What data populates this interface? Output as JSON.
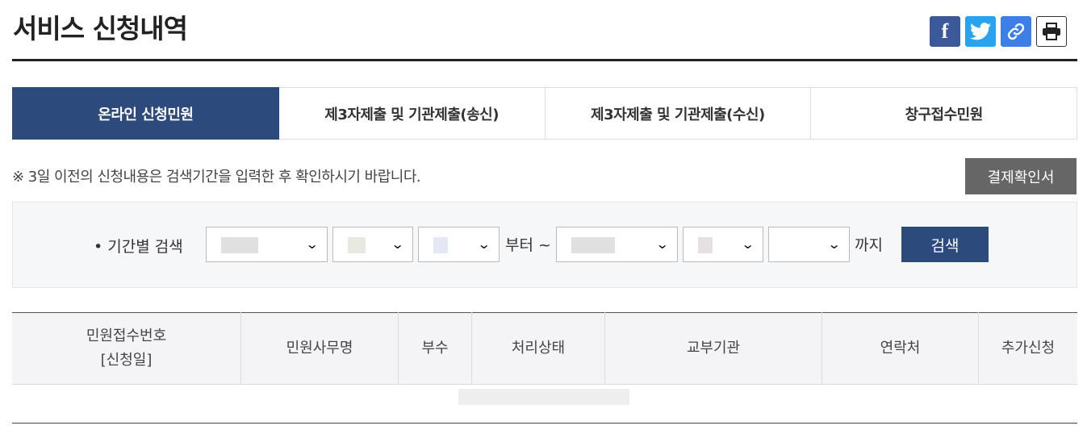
{
  "page": {
    "title": "서비스 신청내역"
  },
  "share": [
    {
      "name": "facebook",
      "glyph": "f"
    },
    {
      "name": "twitter",
      "glyph": "🐦"
    },
    {
      "name": "link",
      "glyph": "🔗"
    },
    {
      "name": "print",
      "glyph": "⎙"
    }
  ],
  "tabs": [
    {
      "label": "온라인 신청민원",
      "active": true
    },
    {
      "label": "제3자제출 및 기관제출(송신)",
      "active": false
    },
    {
      "label": "제3자제출 및 기관제출(수신)",
      "active": false
    },
    {
      "label": "창구접수민원",
      "active": false
    }
  ],
  "notice": "※ 3일 이전의 신청내용은 검색기간을 입력한 후 확인하시기 바랍니다.",
  "pay_button": "결제확인서",
  "search": {
    "label": "• 기간별 검색",
    "from_text": "부터 ~",
    "to_text": "까지",
    "button": "검색"
  },
  "table": {
    "headers": [
      "민원접수번호\n[신청일]",
      "민원사무명",
      "부수",
      "처리상태",
      "교부기관",
      "연락처",
      "추가신청"
    ]
  },
  "colors": {
    "accent": "#2c4a7c",
    "facebook": "#3b5998",
    "twitter": "#2aa3ef",
    "link": "#3c7fe6"
  }
}
